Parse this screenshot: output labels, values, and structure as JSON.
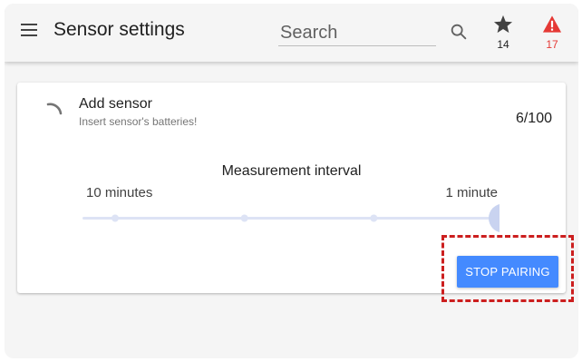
{
  "header": {
    "menu_icon": "hamburger-icon",
    "title": "Sensor settings",
    "search_placeholder": "Search",
    "search_icon": "search-icon",
    "favorites": {
      "icon": "star-icon",
      "count": "14"
    },
    "alerts": {
      "icon": "warning-icon",
      "count": "17",
      "color": "#e53935"
    }
  },
  "card": {
    "spinner_icon": "spinner-icon",
    "title": "Add sensor",
    "subtitle": "Insert sensor's batteries!",
    "count": "6/100",
    "slider": {
      "title": "Measurement interval",
      "min_label": "10 minutes",
      "max_label": "1 minute",
      "steps": 4,
      "value_step": 3,
      "track_color": "#dde3f5",
      "thumb_color": "#c9d3f0"
    },
    "stop_button": {
      "label": "STOP PAIRING",
      "color": "#448aff"
    }
  },
  "annotation": {
    "color": "#cc1f1f"
  }
}
